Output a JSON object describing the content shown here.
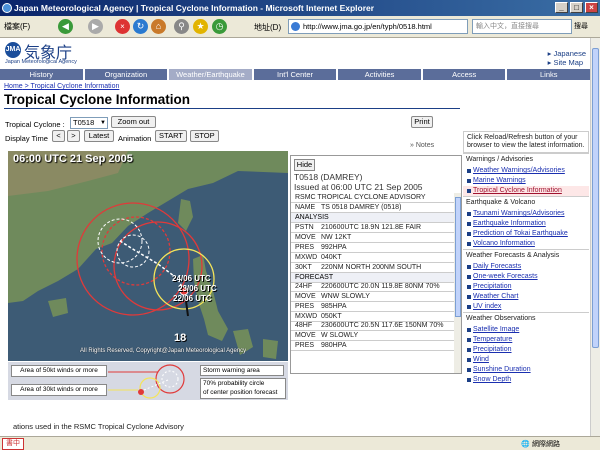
{
  "window": {
    "title": "Japan Meteorological Agency | Tropical Cyclone Information - Microsoft Internet Explorer",
    "menu_file": "檔案(F)",
    "address_label": "地址(D)",
    "url": "http://www.jma.go.jp/en/typh/0518.html",
    "search_placeholder": "輸入中文，直接搜尋",
    "search_go": "搜尋"
  },
  "site": {
    "logo_jp": "気象庁",
    "logo_en": "Japan Meteorological Agency",
    "logo_badge": "JMA",
    "link_japanese": "Japanese",
    "link_sitemap": "Site Map"
  },
  "nav": {
    "tabs": [
      "History",
      "Organization",
      "Weather/Earthquake",
      "Int'l Center",
      "Activities",
      "Access",
      "Links"
    ]
  },
  "breadcrumb": {
    "home": "Home",
    "sep": " > ",
    "current": "Tropical Cyclone Information"
  },
  "page_title": "Tropical Cyclone Information",
  "controls": {
    "cyclone_label": "Tropical Cyclone :",
    "cyclone_value": "T0518",
    "zoom_out": "Zoom out",
    "print": "Print",
    "display_time_label": "Display Time",
    "prev": "<",
    "next": ">",
    "latest": "Latest",
    "animation_label": "Animation",
    "start": "START",
    "stop": "STOP",
    "notes": "» Notes"
  },
  "map": {
    "time": "06:00 UTC  21 Sep 2005",
    "label_24": "24/06 UTC",
    "label_23": "23/06 UTC",
    "label_22": "22/06 UTC",
    "track_number": "18",
    "copyright": "All Rights Reserved, Copyright@Japan Meteorological Agency"
  },
  "legend": {
    "wind50": "Area of 50kt winds or more",
    "wind30": "Area of 30kt winds or more",
    "storm": "Storm warning area",
    "prob_line1": "70% probability circle",
    "prob_line2": "of center position forecast"
  },
  "advisory": {
    "hide": "Hide",
    "name_line": "T0518 (DAMREY)",
    "issued": "Issued at 06:00 UTC 21 Sep 2005",
    "rows": [
      {
        "k": "",
        "v": "RSMC TROPICAL CYCLONE ADVISORY"
      },
      {
        "k": "NAME",
        "v": "TS 0518 DAMREY (0518)"
      },
      {
        "k": "",
        "v": "ANALYSIS"
      },
      {
        "k": "PSTN",
        "v": "210600UTC 18.9N 121.8E FAIR"
      },
      {
        "k": "MOVE",
        "v": "NW 12KT"
      },
      {
        "k": "PRES",
        "v": "992HPA"
      },
      {
        "k": "MXWD",
        "v": "040KT"
      },
      {
        "k": "30KT",
        "v": "220NM NORTH 200NM SOUTH"
      },
      {
        "k": "",
        "v": "FORECAST"
      },
      {
        "k": "24HF",
        "v": "220600UTC 20.0N 119.8E 80NM 70%"
      },
      {
        "k": "MOVE",
        "v": "WNW SLOWLY"
      },
      {
        "k": "PRES",
        "v": "985HPA"
      },
      {
        "k": "MXWD",
        "v": "050KT"
      },
      {
        "k": "48HF",
        "v": "230600UTC 20.5N 117.6E 150NM 70%"
      },
      {
        "k": "MOVE",
        "v": "W SLOWLY"
      },
      {
        "k": "PRES",
        "v": "980HPA"
      }
    ]
  },
  "sidebar": {
    "note": "Click Reload/Refresh button of your browser to view the latest information.",
    "groups": [
      {
        "title": "Warnings / Advisories",
        "items": [
          "Weather Warnings/Advisories",
          "Marine Warnings",
          "Tropical Cyclone Information"
        ]
      },
      {
        "title": "Earthquake & Volcano",
        "items": [
          "Tsunami Warnings/Advisories",
          "Earthquake Information",
          "Prediction of Tokai Earthquake",
          "Volcano Information"
        ]
      },
      {
        "title": "Weather Forecasts & Analysis",
        "items": [
          "Daily Forecasts",
          "One-week Forecasts",
          "Precipitation",
          "Weather Chart",
          "UV index"
        ]
      },
      {
        "title": "Weather Observations",
        "items": [
          "Satellite Image",
          "Temperature",
          "Precipitation",
          "Wind",
          "Sunshine Duration",
          "Snow Depth"
        ]
      }
    ]
  },
  "bottom": {
    "text": "ations used in the RSMC Tropical Cyclone Advisory"
  },
  "status": {
    "zone": "網際網路",
    "ime": "書中"
  }
}
